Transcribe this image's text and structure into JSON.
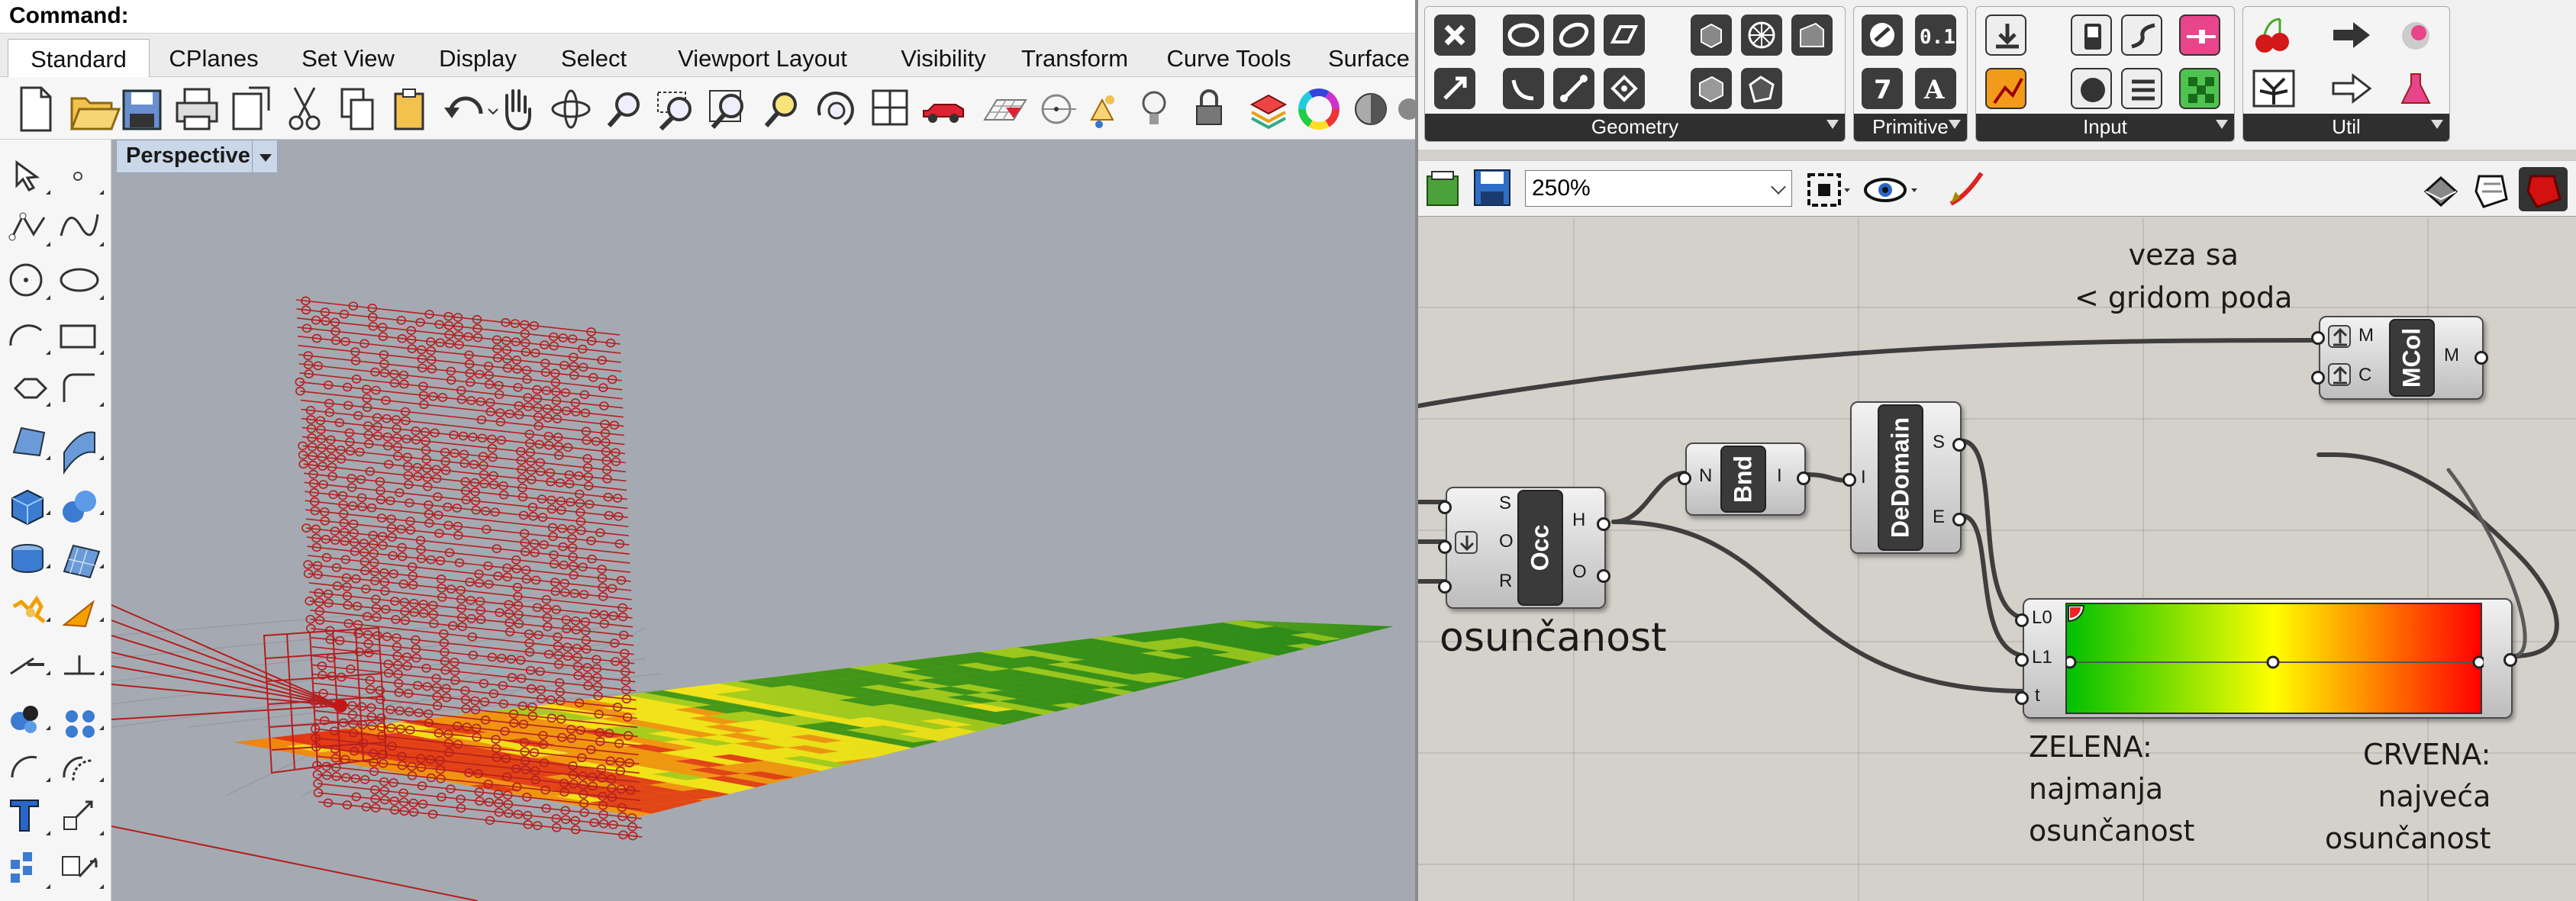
{
  "rhino": {
    "command_label": "Command:",
    "tabs": [
      {
        "label": "Standard",
        "active": true
      },
      {
        "label": "CPlanes"
      },
      {
        "label": "Set View"
      },
      {
        "label": "Display"
      },
      {
        "label": "Select"
      },
      {
        "label": "Viewport Layout"
      },
      {
        "label": "Visibility"
      },
      {
        "label": "Transform"
      },
      {
        "label": "Curve Tools"
      },
      {
        "label": "Surface"
      }
    ],
    "main_toolbar_icons": [
      "new-icon",
      "open-icon",
      "save-icon",
      "print-icon",
      "import-icon",
      "cut-icon",
      "copy-icon",
      "paste-icon",
      "undo-icon",
      "pan-icon",
      "rotate-view-icon",
      "zoom-icon",
      "zoom-window-icon",
      "zoom-extents-icon",
      "zoom-selected-icon",
      "rotate-camera-icon",
      "four-viewports-icon",
      "car-render-icon",
      "grid-icon",
      "circle-tool-icon",
      "points-icon",
      "light-bulb-icon",
      "lock-icon",
      "layers-icon",
      "color-wheel-icon",
      "material-sphere-icon"
    ],
    "left_toolbar_icons": [
      "select-arrow-icon",
      "point-icon",
      "polyline-icon",
      "curve-icon",
      "circle-icon",
      "ellipse-icon",
      "arc-icon",
      "rectangle-icon",
      "polygon-icon",
      "fillet-icon",
      "surface-corner-icon",
      "surface-extrude-icon",
      "box-icon",
      "boolean-union-icon",
      "cylinder-icon",
      "mesh-plane-icon",
      "explode-icon",
      "split-icon",
      "extend-icon",
      "trim-icon",
      "group-icon",
      "array-icon",
      "join-icon",
      "offset-icon",
      "text-icon",
      "scale-icon",
      "dimension-icon",
      "move-icon"
    ],
    "viewport": {
      "label": "Perspective"
    }
  },
  "gh": {
    "panels": [
      {
        "label": "Geometry"
      },
      {
        "label": "Primitive"
      },
      {
        "label": "Input"
      },
      {
        "label": "Util"
      }
    ],
    "zoom_value": "250%",
    "notes": {
      "veza": "veza sa\n< gridom poda",
      "osuncanost": "osunčanost",
      "zelena": "ZELENA:\nnajmanja\nosunčanost",
      "crvena": "CRVENA:\nnajveća\nosunčanost"
    },
    "components": {
      "occ": {
        "name": "Occ",
        "inputs": [
          "S",
          "O",
          "R"
        ],
        "outputs": [
          "H",
          "O"
        ]
      },
      "bnd": {
        "name": "Bnd",
        "inputs": [
          "N"
        ],
        "outputs": [
          "I"
        ]
      },
      "dedomain": {
        "name": "DeDomain",
        "inputs": [
          "I"
        ],
        "outputs": [
          "S",
          "E"
        ]
      },
      "mcol": {
        "name": "MCol",
        "inputs": [
          "M",
          "C"
        ],
        "outputs": [
          "M"
        ]
      },
      "gradient": {
        "inputs": [
          "L0",
          "L1",
          "t"
        ],
        "colors": [
          "#00c000",
          "#ffff00",
          "#ff0000"
        ]
      }
    }
  }
}
